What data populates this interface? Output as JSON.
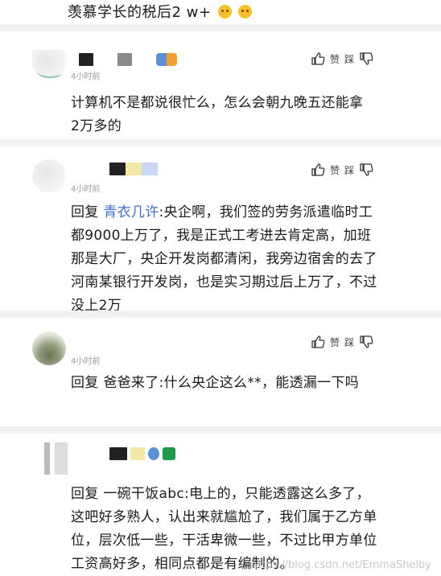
{
  "top": {
    "text": "羡慕学长的税后2 w+"
  },
  "actions": {
    "like_label": "赞",
    "dislike_label": "踩"
  },
  "comments": [
    {
      "time": "4小时前",
      "text": "计算机不是都说很忙么，怎么会朝九晚五还能拿\n2万多的"
    },
    {
      "time": "4小时前",
      "reply_prefix": "回复",
      "reply_to": "青衣几许",
      "reply_text": ":央企啊，我们签的劳务派遣临时工都9000上万了，我是正式工考进去肯定高，加班那是大厂，央企开发岗都清闲，我旁边宿舍的去了河南某银行开发岗，也是实习期过后上万了，不过没上2万"
    },
    {
      "time": "4小时前",
      "reply_prefix": "回复",
      "reply_to": "爸爸来了",
      "reply_text": ":什么央企这么**，能透漏一下吗"
    },
    {
      "reply_prefix": "回复",
      "reply_to": "一碗干饭abc",
      "reply_text": ":电上的，只能透露这么多了，这吧好多熟人，认出来就尴尬了，我们属于乙方单位，层次低一些，干活卑微一些，不过比甲方单位工资高好多，相同点都是有编制的。"
    }
  ],
  "watermark": "https://blog.csdn.net/EmmaShelby"
}
